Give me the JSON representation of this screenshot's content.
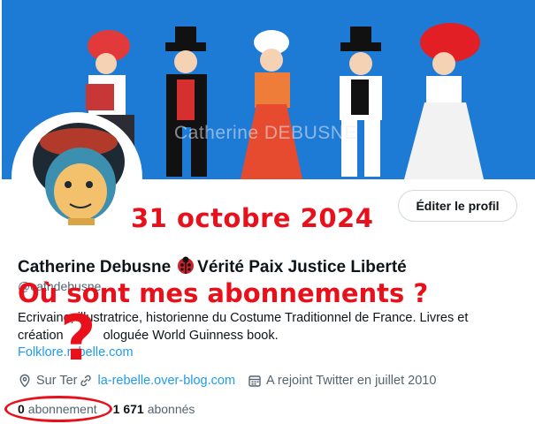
{
  "banner": {
    "watermark": "Catherine DEBUSNE"
  },
  "profile": {
    "edit_button": "Éditer le profil",
    "name": "Catherine Debusne",
    "name_suffix": "Vérité Paix Justice Liberté",
    "handle": "@cathdebusne",
    "bio_line1": "Ecrivaine, illustratrice, historienne du Costume Traditionnel de France. Livres et",
    "bio_line2_start": "création",
    "bio_line2_end": "ologuée World Guinness book.",
    "bio_link": "Folklore.rebelle.com",
    "meta": {
      "location": "Sur Ter",
      "website": "la-rebelle.over-blog.com",
      "joined": "A rejoint Twitter en juillet 2010"
    },
    "stats": {
      "following_count": "0",
      "following_label": "abonnement",
      "followers_count": "1 671",
      "followers_label": "abonnés"
    }
  },
  "annotations": {
    "date": "31 octobre 2024",
    "question": "Où sont mes abonnements ?",
    "mark": "?",
    "color": "#e8101a"
  },
  "colors": {
    "link": "#1d9bf0",
    "banner": "#1d7bd6",
    "muted": "#536471"
  },
  "icons": [
    "ladybug-icon",
    "location-icon",
    "link-icon",
    "calendar-icon"
  ]
}
